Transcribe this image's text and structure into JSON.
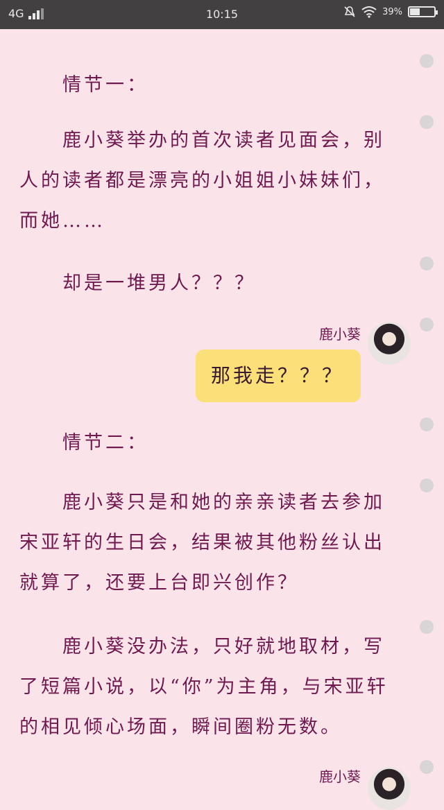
{
  "status_bar": {
    "network": "4G",
    "time": "10:15",
    "battery_percent": "39%",
    "battery_level": 0.39,
    "icons": [
      "signal-icon",
      "mute-icon",
      "wifi-icon",
      "battery-icon"
    ]
  },
  "paragraphs": [
    {
      "text": "情节一：",
      "indent": true
    },
    {
      "text": "鹿小葵举办的首次读者见面会，别人的读者都是漂亮的小姐姐小妹妹们，而她……",
      "indent": true
    },
    {
      "text": "却是一堆男人？？？",
      "indent": true
    },
    {
      "text": "情节二：",
      "indent": true
    },
    {
      "text": "鹿小葵只是和她的亲亲读者去参加宋亚轩的生日会，结果被其他粉丝认出就算了，还要上台即兴创作？",
      "indent": true
    },
    {
      "text": "鹿小葵没办法，只好就地取材，写了短篇小说，以“你”为主角，与宋亚轩的相见倾心场面，瞬间圈粉无数。",
      "indent": true
    }
  ],
  "chat": [
    {
      "name": "鹿小葵",
      "message": "那我走？？？"
    },
    {
      "name": "鹿小葵",
      "message": ""
    }
  ],
  "colors": {
    "background": "#fbe3ea",
    "text": "#6e1a4e",
    "bubble": "#fbe07a",
    "status_bar": "#434042"
  }
}
